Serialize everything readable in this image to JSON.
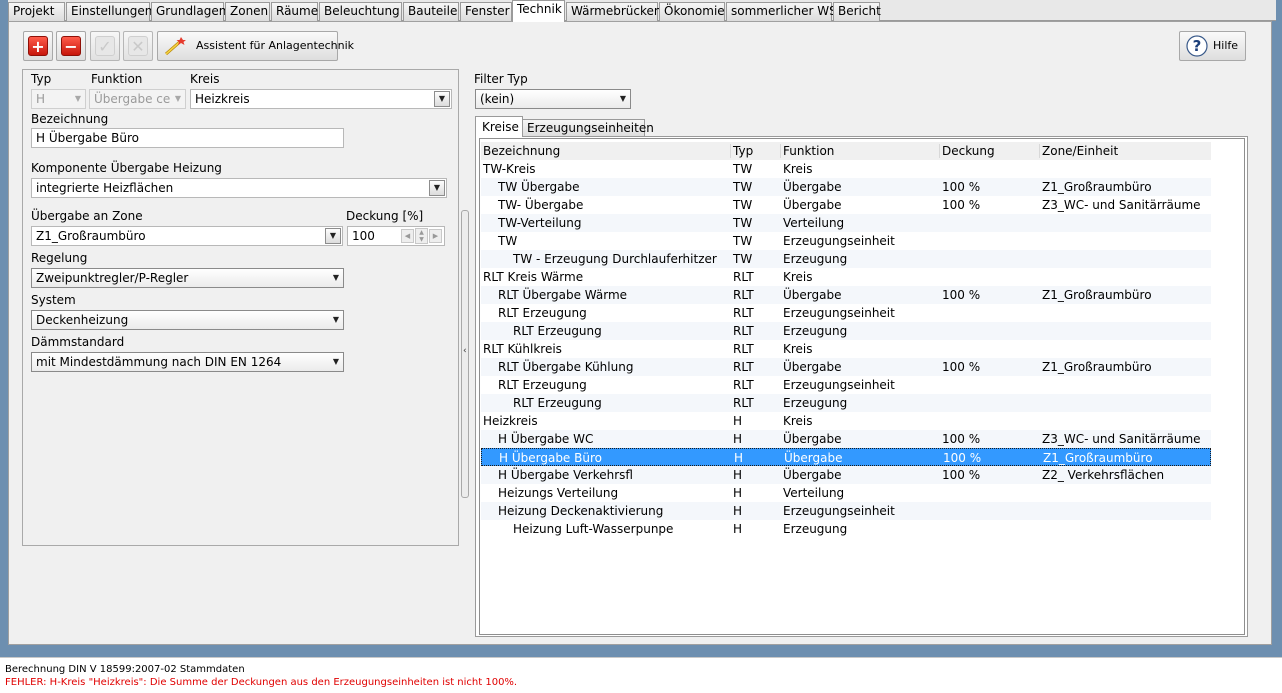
{
  "tabs": [
    {
      "label": "Projekt",
      "active": false
    },
    {
      "label": "Einstellungen",
      "active": false
    },
    {
      "label": "Grundlagen",
      "active": false
    },
    {
      "label": "Zonen",
      "active": false
    },
    {
      "label": "Räume",
      "active": false
    },
    {
      "label": "Beleuchtung",
      "active": false
    },
    {
      "label": "Bauteile",
      "active": false
    },
    {
      "label": "Fenster",
      "active": false
    },
    {
      "label": "Technik",
      "active": true
    },
    {
      "label": "Wärmebrücken",
      "active": false
    },
    {
      "label": "Ökonomie",
      "active": false
    },
    {
      "label": "sommerlicher WS",
      "active": false
    },
    {
      "label": "Bericht",
      "active": false
    }
  ],
  "toolbar": {
    "add_icon": "plus-icon",
    "remove_icon": "minus-icon",
    "confirm_icon": "check-icon",
    "cancel_icon": "x-icon",
    "assistant_icon": "wand-icon",
    "assistant_label": "Assistent für Anlagentechnik",
    "help_icon": "question-icon",
    "help_label": "Hilfe"
  },
  "form": {
    "typ_label": "Typ",
    "typ_value": "H",
    "funktion_label": "Funktion",
    "funktion_value": "Übergabe ce",
    "kreis_label": "Kreis",
    "kreis_value": "Heizkreis",
    "bezeichnung_label": "Bezeichnung",
    "bezeichnung_value": "H Übergabe Büro",
    "komponente_label": "Komponente Übergabe Heizung",
    "komponente_value": "integrierte Heizflächen",
    "zone_label": "Übergabe an Zone",
    "zone_value": "Z1_Großraumbüro",
    "deckung_label": "Deckung [%]",
    "deckung_value": "100",
    "regelung_label": "Regelung",
    "regelung_value": "Zweipunktregler/P-Regler",
    "system_label": "System",
    "system_value": "Deckenheizung",
    "daemm_label": "Dämmstandard",
    "daemm_value": "mit Mindestdämmung nach DIN EN 1264"
  },
  "filter": {
    "label": "Filter Typ",
    "value": "(kein)"
  },
  "subtabs": [
    {
      "label": "Kreise",
      "active": true
    },
    {
      "label": "Erzeugungseinheiten",
      "active": false
    }
  ],
  "table": {
    "headers": [
      "Bezeichnung",
      "Typ",
      "Funktion",
      "Deckung",
      "Zone/Einheit"
    ],
    "rows": [
      {
        "name": "TW-Kreis",
        "level": 0,
        "typ": "TW",
        "funktion": "Kreis",
        "deckung": "",
        "zone": ""
      },
      {
        "name": "TW Übergabe",
        "level": 1,
        "typ": "TW",
        "funktion": "Übergabe",
        "deckung": "100 %",
        "zone": "Z1_Großraumbüro"
      },
      {
        "name": "TW- Übergabe",
        "level": 1,
        "typ": "TW",
        "funktion": "Übergabe",
        "deckung": "100 %",
        "zone": "Z3_WC- und Sanitärräume"
      },
      {
        "name": "TW-Verteilung",
        "level": 1,
        "typ": "TW",
        "funktion": "Verteilung",
        "deckung": "",
        "zone": ""
      },
      {
        "name": "TW",
        "level": 1,
        "typ": "TW",
        "funktion": "Erzeugungseinheit",
        "deckung": "",
        "zone": ""
      },
      {
        "name": "TW - Erzeugung Durchlauferhitzer",
        "level": 2,
        "typ": "TW",
        "funktion": "Erzeugung",
        "deckung": "",
        "zone": ""
      },
      {
        "name": "RLT Kreis Wärme",
        "level": 0,
        "typ": "RLT",
        "funktion": "Kreis",
        "deckung": "",
        "zone": ""
      },
      {
        "name": "RLT Übergabe Wärme",
        "level": 1,
        "typ": "RLT",
        "funktion": "Übergabe",
        "deckung": "100 %",
        "zone": "Z1_Großraumbüro"
      },
      {
        "name": "RLT Erzeugung",
        "level": 1,
        "typ": "RLT",
        "funktion": "Erzeugungseinheit",
        "deckung": "",
        "zone": ""
      },
      {
        "name": "RLT Erzeugung",
        "level": 2,
        "typ": "RLT",
        "funktion": "Erzeugung",
        "deckung": "",
        "zone": ""
      },
      {
        "name": "RLT Kühlkreis",
        "level": 0,
        "typ": "RLT",
        "funktion": "Kreis",
        "deckung": "",
        "zone": ""
      },
      {
        "name": "RLT Übergabe Kühlung",
        "level": 1,
        "typ": "RLT",
        "funktion": "Übergabe",
        "deckung": "100 %",
        "zone": "Z1_Großraumbüro"
      },
      {
        "name": "RLT Erzeugung",
        "level": 1,
        "typ": "RLT",
        "funktion": "Erzeugungseinheit",
        "deckung": "",
        "zone": ""
      },
      {
        "name": "RLT Erzeugung",
        "level": 2,
        "typ": "RLT",
        "funktion": "Erzeugung",
        "deckung": "",
        "zone": ""
      },
      {
        "name": "Heizkreis",
        "level": 0,
        "typ": "H",
        "funktion": "Kreis",
        "deckung": "",
        "zone": ""
      },
      {
        "name": "H Übergabe WC",
        "level": 1,
        "typ": "H",
        "funktion": "Übergabe",
        "deckung": "100 %",
        "zone": "Z3_WC- und Sanitärräume"
      },
      {
        "name": "H Übergabe Büro",
        "level": 1,
        "typ": "H",
        "funktion": "Übergabe",
        "deckung": "100 %",
        "zone": "Z1_Großraumbüro",
        "selected": true
      },
      {
        "name": "H Übergabe Verkehrsfl",
        "level": 1,
        "typ": "H",
        "funktion": "Übergabe",
        "deckung": "100 %",
        "zone": "Z2_ Verkehrsflächen"
      },
      {
        "name": "Heizungs Verteilung",
        "level": 1,
        "typ": "H",
        "funktion": "Verteilung",
        "deckung": "",
        "zone": ""
      },
      {
        "name": "Heizung Deckenaktivierung",
        "level": 1,
        "typ": "H",
        "funktion": "Erzeugungseinheit",
        "deckung": "",
        "zone": ""
      },
      {
        "name": "Heizung Luft-Wasserpunpe",
        "level": 2,
        "typ": "H",
        "funktion": "Erzeugung",
        "deckung": "",
        "zone": ""
      }
    ]
  },
  "status": {
    "line1": "Berechnung DIN V 18599:2007-02 Stammdaten",
    "line2": "FEHLER: H-Kreis \"Heizkreis\": Die Summe der Deckungen aus den Erzeugungseinheiten ist nicht 100%.",
    "error_color": "#e00000"
  },
  "colors": {
    "selection": "#3399ff",
    "frame": "#6d8fb0"
  }
}
